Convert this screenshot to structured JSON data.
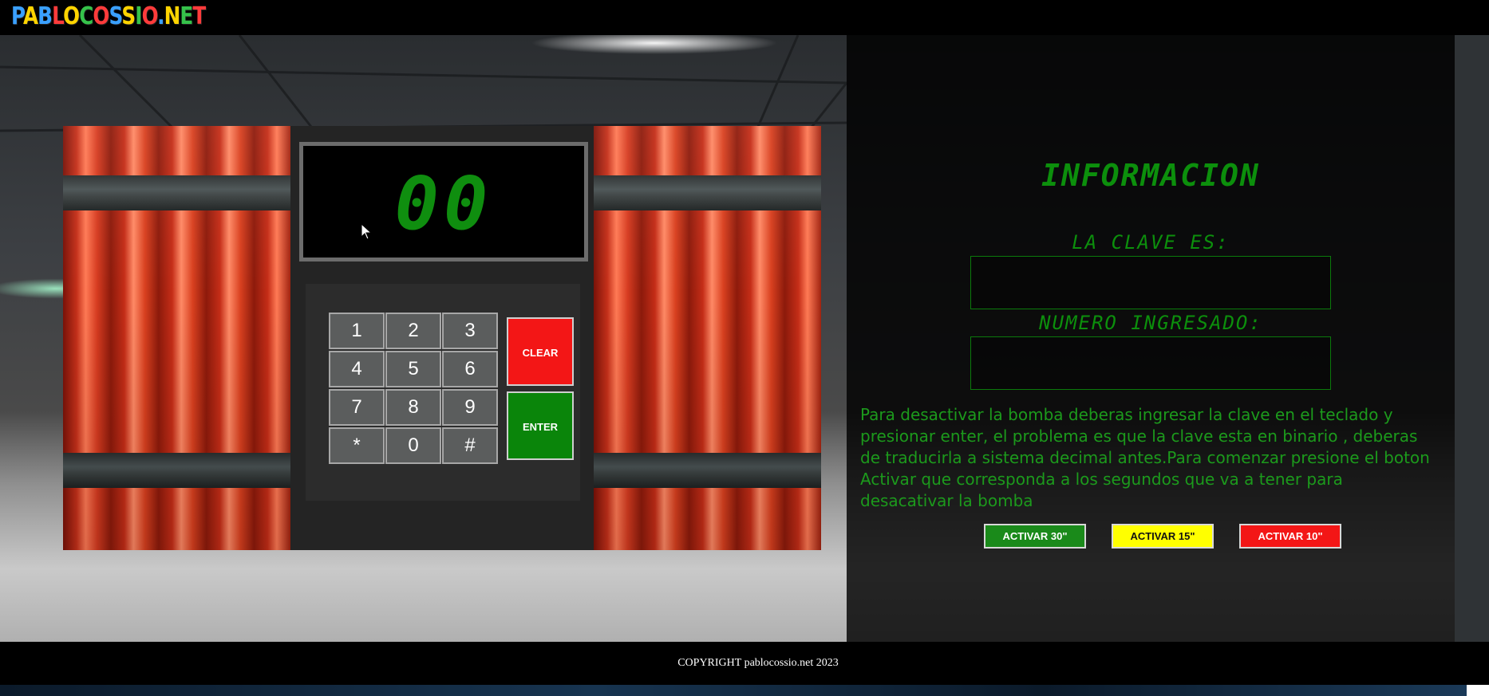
{
  "header": {
    "logo_text": "PABLOCOSSIO.NET"
  },
  "bomb": {
    "display": "00",
    "keypad": [
      "1",
      "2",
      "3",
      "4",
      "5",
      "6",
      "7",
      "8",
      "9",
      "*",
      "0",
      "#"
    ],
    "clear_label": "CLEAR",
    "enter_label": "ENTER"
  },
  "info": {
    "title": "INFORMACION",
    "clave_label": "LA CLAVE ES:",
    "clave_value": "",
    "numero_label": "NUMERO INGRESADO:",
    "numero_value": "",
    "instructions": "Para desactivar la bomba deberas ingresar la clave en el teclado y presionar enter, el problema es que la clave esta en binario , deberas de traducirla a sistema decimal antes.Para comenzar presione el boton Activar que corresponda a los segundos que va a tener para desacativar la bomba",
    "buttons": {
      "activar_30": "ACTIVAR 30\"",
      "activar_15": "ACTIVAR 15\"",
      "activar_10": "ACTIVAR 10\""
    }
  },
  "footer": {
    "copyright": "COPYRIGHT pablocossio.net 2023"
  },
  "colors": {
    "lcd_green": "#0c8f0c",
    "clear_red": "#f31616",
    "enter_green": "#0a850a",
    "activar_15_yellow": "#ffff00"
  }
}
